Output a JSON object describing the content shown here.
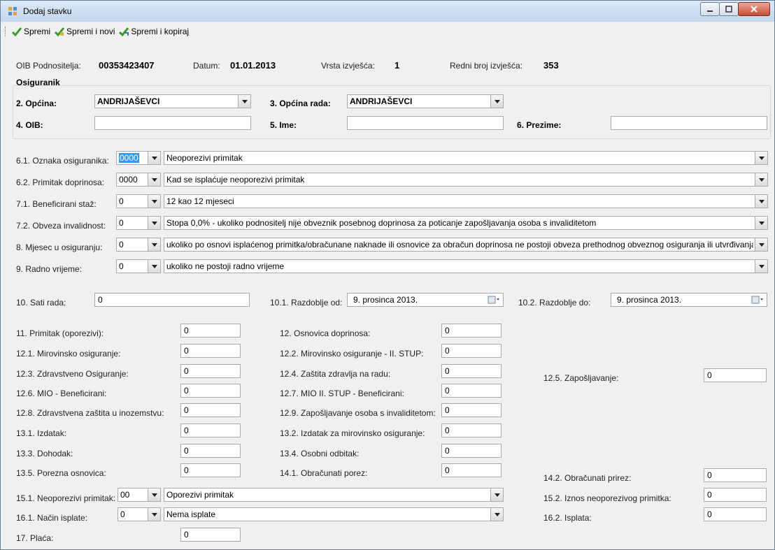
{
  "window": {
    "title": "Dodaj stavku"
  },
  "toolbar": {
    "save": "Spremi",
    "save_new": "Spremi i novi",
    "save_copy": "Spremi i kopiraj"
  },
  "header": {
    "oib_label": "OIB Podnositelja:",
    "oib_value": "00353423407",
    "datum_label": "Datum:",
    "datum_value": "01.01.2013",
    "vrsta_label": "Vrsta izvješća:",
    "vrsta_value": "1",
    "redni_label": "Redni broj izvješća:",
    "redni_value": "353"
  },
  "osiguranik": {
    "title": "Osiguranik",
    "opcina_label": "2. Općina:",
    "opcina_value": "ANDRIJAŠEVCI",
    "opcina_rada_label": "3. Općina rada:",
    "opcina_rada_value": "ANDRIJAŠEVCI",
    "oib_label": "4. OIB:",
    "oib_value": "",
    "ime_label": "5. Ime:",
    "ime_value": "",
    "prezime_label": "6. Prezime:",
    "prezime_value": ""
  },
  "codes": [
    {
      "label": "6.1. Oznaka osiguranika:",
      "code": "0000",
      "desc": "Neoporezivi primitak"
    },
    {
      "label": "6.2. Primitak doprinosa:",
      "code": "0000",
      "desc": "Kad se isplaćuje neoporezivi primitak"
    },
    {
      "label": "7.1. Beneficirani staž:",
      "code": "0",
      "desc": "12 kao 12 mjeseci"
    },
    {
      "label": "7.2. Obveza invalidnost:",
      "code": "0",
      "desc": "Stopa 0,0%  - ukoliko podnositelj nije obveznik posebnog doprinosa za poticanje zapošljavanja osoba s invaliditetom"
    },
    {
      "label": "8. Mjesec u osiguranju:",
      "code": "0",
      "desc": "ukoliko po osnovi isplaćenog primitka/obračunane naknade ili osnovice za obračun doprinosa ne postoji obveza prethodnog obveznog osiguranja ili utvrđivanja"
    },
    {
      "label": "9. Radno vrijeme:",
      "code": "0",
      "desc": "ukoliko ne postoji radno vrijeme"
    }
  ],
  "period": {
    "sati_label": "10. Sati rada:",
    "sati_value": "0",
    "od_label": "10.1. Razdoblje od:",
    "od_value": "9. prosinca  2013.",
    "do_label": "10.2. Razdoblje do:",
    "do_value": "9. prosinca  2013."
  },
  "col1": [
    {
      "label": "11. Primitak (oporezivi):",
      "value": "0"
    },
    {
      "label": "12.1. Mirovinsko osiguranje:",
      "value": "0"
    },
    {
      "label": "12.3. Zdravstveno Osiguranje:",
      "value": "0"
    },
    {
      "label": "12.6. MIO - Beneficirani:",
      "value": "0"
    },
    {
      "label": "12.8. Zdravstvena zaštita u inozemstvu:",
      "value": "0"
    },
    {
      "label": "13.1. Izdatak:",
      "value": "0"
    },
    {
      "label": "13.3. Dohodak:",
      "value": "0"
    },
    {
      "label": "13.5. Porezna osnovica:",
      "value": "0"
    }
  ],
  "col2": [
    {
      "label": "12. Osnovica doprinosa:",
      "value": "0"
    },
    {
      "label": "12.2. Mirovinsko osiguranje - II. STUP:",
      "value": "0"
    },
    {
      "label": "12.4. Zaštita zdravlja na radu:",
      "value": "0"
    },
    {
      "label": "12.7. MIO II. STUP - Beneficirani:",
      "value": "0"
    },
    {
      "label": "12.9. Zapošljavanje osoba s invaliditetom:",
      "value": "0"
    },
    {
      "label": "13.2. Izdatak za mirovinsko osiguranje:",
      "value": "0"
    },
    {
      "label": "13.4. Osobni odbitak:",
      "value": "0"
    },
    {
      "label": "14.1. Obračunati porez:",
      "value": "0"
    }
  ],
  "col3": {
    "zaposljavanje_label": "12.5. Zapošljavanje:",
    "zaposljavanje_value": "0",
    "prirez_label": "14.2. Obračunati prirez:",
    "prirez_value": "0",
    "iznos_label": "15.2. Iznos neoporezivog primitka:",
    "iznos_value": "0",
    "isplata_label": "16.2. Isplata:",
    "isplata_value": "0"
  },
  "bottom": {
    "neoporezivi_label": "15.1. Neoporezivi primitak:",
    "neoporezivi_code": "00",
    "neoporezivi_desc": "Oporezivi primitak",
    "nacin_label": "16.1. Način isplate:",
    "nacin_code": "0",
    "nacin_desc": "Nema isplate",
    "placa_label": "17. Plaća:",
    "placa_value": "0"
  }
}
